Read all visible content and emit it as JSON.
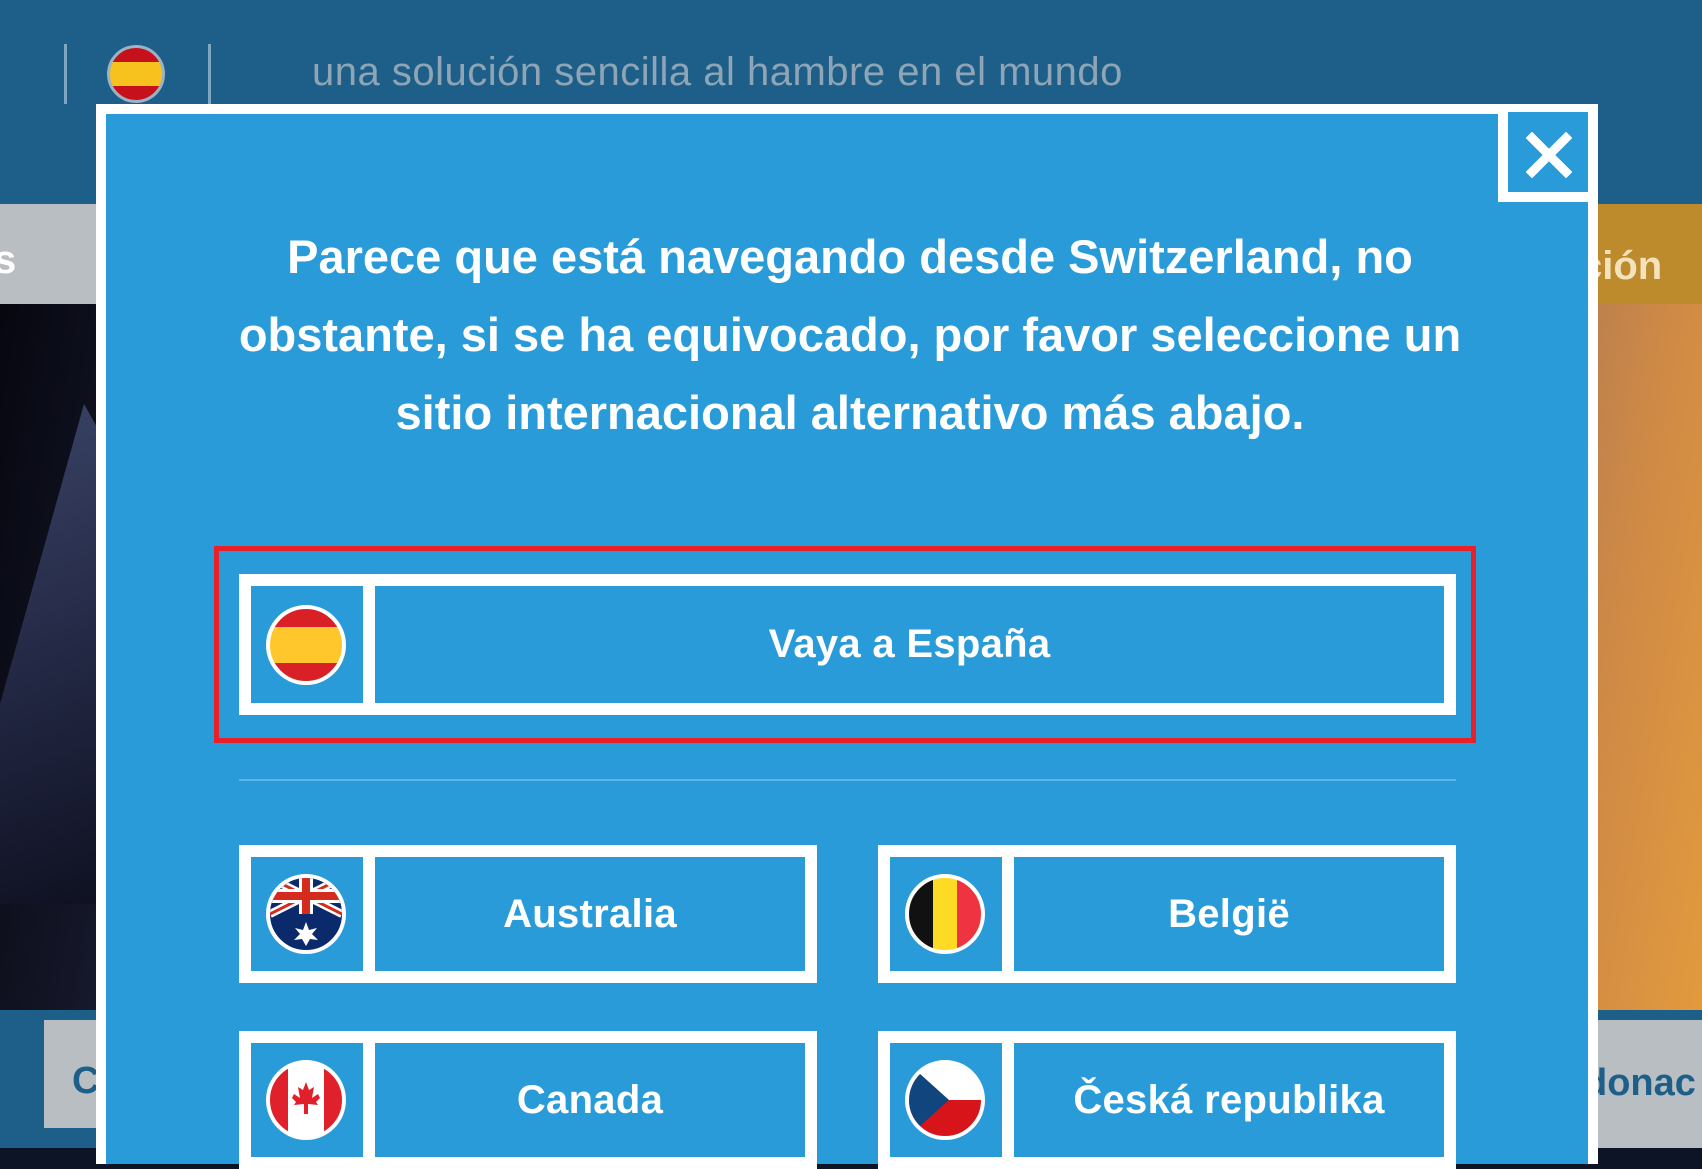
{
  "header": {
    "tagline": "una solución sencilla al hambre en el mundo",
    "language_icon": "spain-flag-icon"
  },
  "background": {
    "nav_partial_left": "s",
    "cta_partial_right": "ción",
    "bottom_partial_left": "C",
    "bottom_partial_right": "donac"
  },
  "modal": {
    "message": "Parece que está navegando desde Switzerland, no obstante, si se ha equivocado, por favor seleccione un sitio internacional alternativo más abajo.",
    "close_icon": "close-icon",
    "primary": {
      "label": "Vaya a España",
      "flag_icon": "spain-flag-icon"
    },
    "countries": [
      {
        "label": "Australia",
        "flag_icon": "australia-flag-icon"
      },
      {
        "label": "België",
        "flag_icon": "belgium-flag-icon"
      },
      {
        "label": "Canada",
        "flag_icon": "canada-flag-icon"
      },
      {
        "label": "Česká republika",
        "flag_icon": "czech-flag-icon"
      }
    ]
  },
  "colors": {
    "modal_bg": "#299bd9",
    "highlight": "#e8202a",
    "header_bg": "#1e5f8a",
    "cta_bg": "#bd8a2c"
  }
}
